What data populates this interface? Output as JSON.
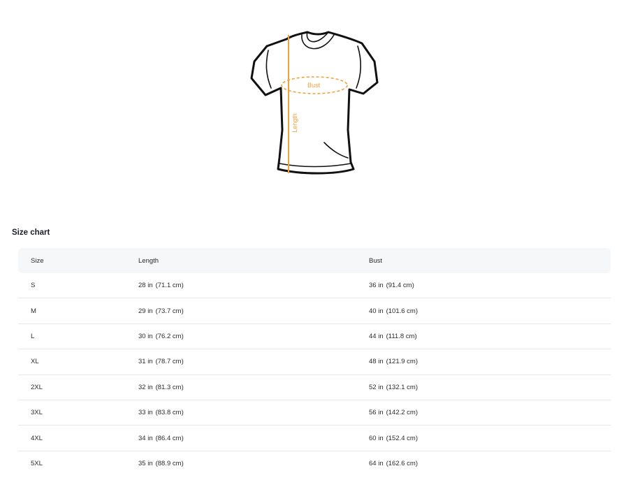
{
  "diagram": {
    "bust_label": "Bust",
    "length_label": "Length",
    "accent_color": "#f0a23a"
  },
  "size_chart": {
    "title": "Size chart",
    "headers": [
      "Size",
      "Length",
      "Bust"
    ],
    "rows": [
      {
        "size": "S",
        "length": "28 in",
        "length_cm": "(71.1 cm)",
        "bust": "36 in",
        "bust_cm": "(91.4 cm)"
      },
      {
        "size": "M",
        "length": "29 in",
        "length_cm": "(73.7 cm)",
        "bust": "40 in",
        "bust_cm": "(101.6 cm)"
      },
      {
        "size": "L",
        "length": "30 in",
        "length_cm": "(76.2 cm)",
        "bust": "44 in",
        "bust_cm": "(111.8 cm)"
      },
      {
        "size": "XL",
        "length": "31 in",
        "length_cm": "(78.7 cm)",
        "bust": "48 in",
        "bust_cm": "(121.9 cm)"
      },
      {
        "size": "2XL",
        "length": "32 in",
        "length_cm": "(81.3 cm)",
        "bust": "52 in",
        "bust_cm": "(132.1 cm)"
      },
      {
        "size": "3XL",
        "length": "33 in",
        "length_cm": "(83.8 cm)",
        "bust": "56 in",
        "bust_cm": "(142.2 cm)"
      },
      {
        "size": "4XL",
        "length": "34 in",
        "length_cm": "(86.4 cm)",
        "bust": "60 in",
        "bust_cm": "(152.4 cm)"
      },
      {
        "size": "5XL",
        "length": "35 in",
        "length_cm": "(88.9 cm)",
        "bust": "64 in",
        "bust_cm": "(162.6 cm)"
      }
    ]
  }
}
